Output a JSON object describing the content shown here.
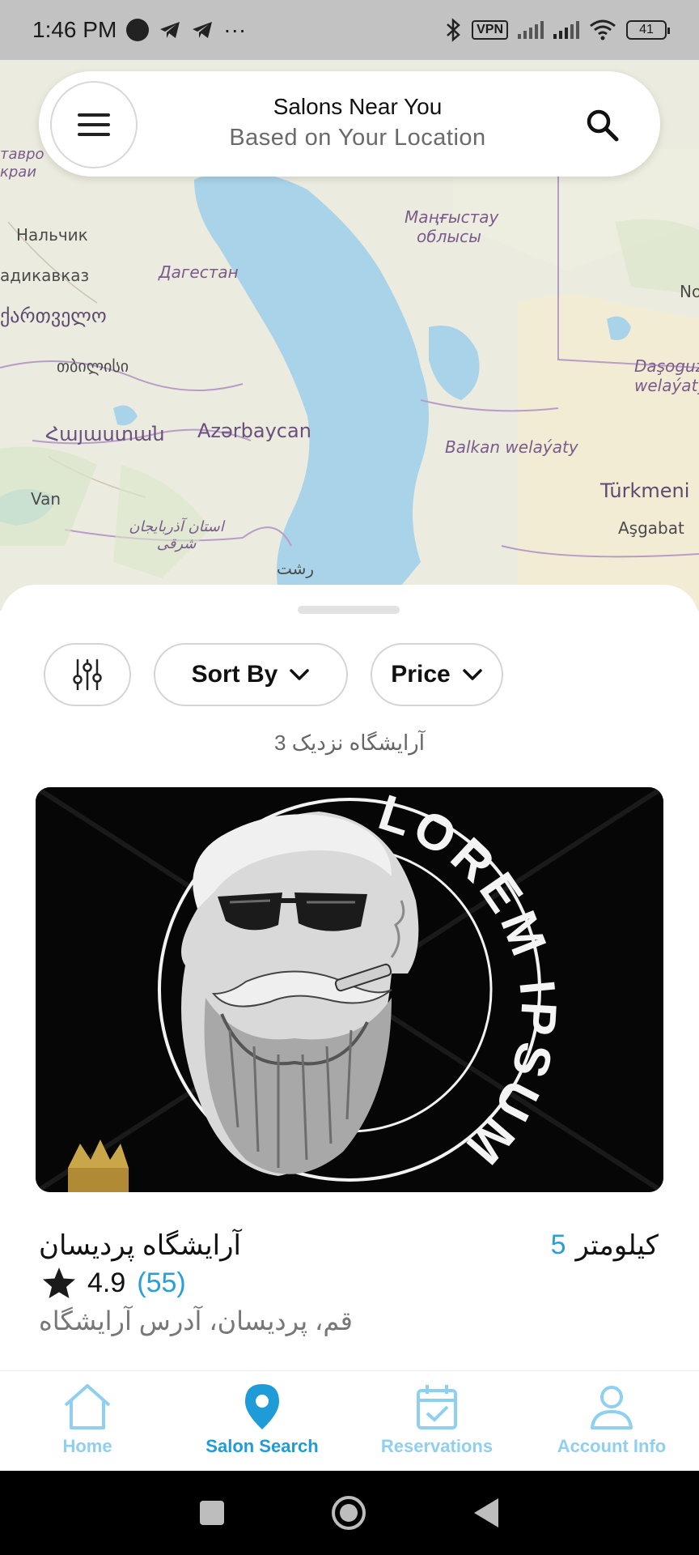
{
  "status_bar": {
    "time": "1:46 PM",
    "dots": "···",
    "vpn": "VPN",
    "battery": "41"
  },
  "map": {
    "labels": [
      "тавро крaи",
      "Нальчик",
      "Дагестан",
      "адикавказ",
      "ქართველო",
      "თბილისი",
      "Հայաստան",
      "Azərbaycan",
      "Van",
      "استان آذربایجان شرقی",
      "رشت",
      "Маңғыстау облысы",
      "Balkan welaýaty",
      "Türkmeni",
      "Aşgabat",
      "Daşoguz welaýaty",
      "No"
    ]
  },
  "header": {
    "title": "Salons Near You",
    "subtitle": "Based on Your Location"
  },
  "filters": {
    "sort_label": "Sort By",
    "price_label": "Price"
  },
  "results": {
    "count_text": "آرایشگاه نزدیک 3"
  },
  "salon": {
    "name": "آرایشگاه پردیسان",
    "distance_value": "5",
    "distance_unit": "کیلومتر",
    "rating": "4.9",
    "reviews": "(55)",
    "address": "قم، پردیسان، آدرس آرایشگاه",
    "image_text": "LOREM IPSUM"
  },
  "nav": {
    "items": [
      {
        "label": "Home"
      },
      {
        "label": "Salon Search"
      },
      {
        "label": "Reservations"
      },
      {
        "label": "Account Info"
      }
    ],
    "accent": "#1f9bd7",
    "inactive": "#8fcff0"
  }
}
